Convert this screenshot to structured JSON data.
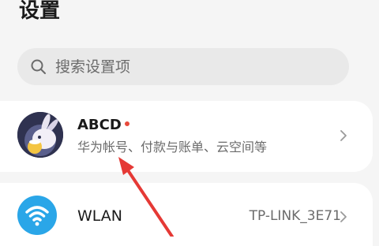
{
  "header": {
    "title": "设置"
  },
  "search": {
    "placeholder": "搜索设置项",
    "icon": "search-icon"
  },
  "account": {
    "name": "ABCD",
    "subtitle": "华为帐号、付款与账单、云空间等",
    "has_notification": true,
    "avatar": "avatar-rabbit"
  },
  "wlan": {
    "title": "WLAN",
    "value": "TP-LINK_3E71",
    "icon": "wifi-icon"
  },
  "annotation": {
    "color": "#e53935"
  },
  "colors": {
    "accent_blue": "#2aa6e8",
    "notify_red": "#e84a3c"
  }
}
